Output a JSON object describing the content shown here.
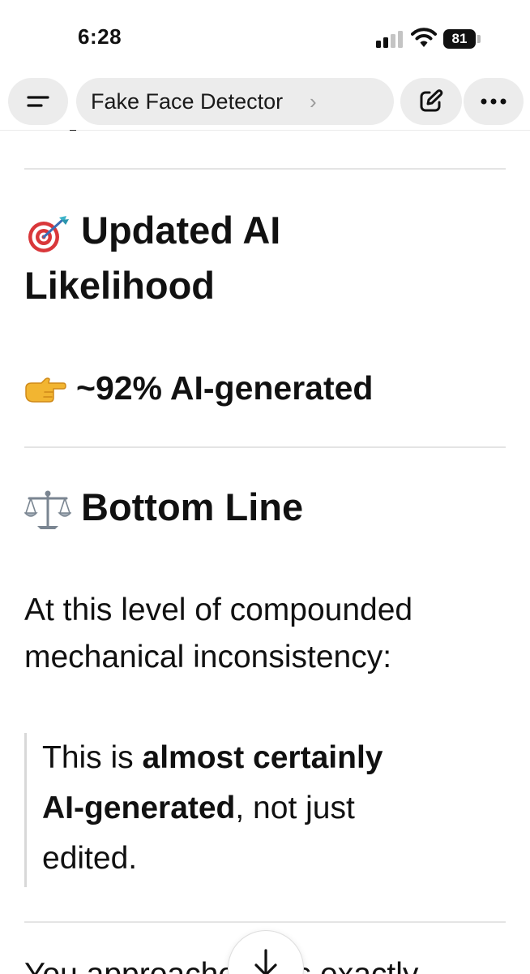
{
  "status_bar": {
    "time": "6:28",
    "battery": "81"
  },
  "header": {
    "title": "Fake Face Detector",
    "chevron": "›",
    "menu_icon": "menu-icon",
    "edit_icon": "edit-icon",
    "more_icon": "more-icon"
  },
  "content": {
    "section1": {
      "emoji_icon": "target-icon",
      "heading_line1": "Updated AI",
      "heading_line2": "Likelihood"
    },
    "likelihood": {
      "emoji_icon": "pointing-hand-icon",
      "text": "~92% AI-generated"
    },
    "section2": {
      "emoji_icon": "balance-scale-icon",
      "heading": "Bottom Line"
    },
    "paragraph_line1": "At this level of compounded",
    "paragraph_line2": "mechanical inconsistency:",
    "quote": {
      "part1": "This is ",
      "bold1": "almost certainly",
      "bold2": "AI-generated",
      "part2": ", not just",
      "part3": "edited."
    },
    "bottom_text": "You approached this exactly"
  },
  "colors": {
    "pill_bg": "#ececec",
    "text": "#111111",
    "divider": "#e4e4e4",
    "quote_border": "#d8d8d8"
  }
}
